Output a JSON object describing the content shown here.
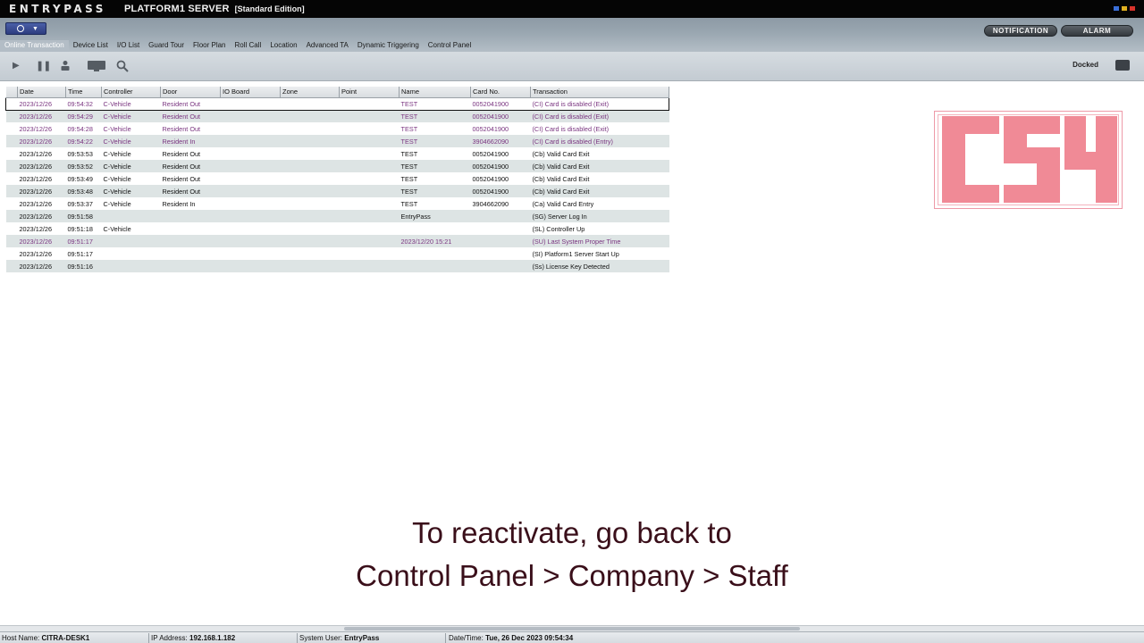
{
  "titlebar": {
    "logo": "ENTRYPASS",
    "product": "PLATFORM1 SERVER",
    "edition": "[Standard Edition]"
  },
  "tabs": [
    {
      "label": "Online Transaction",
      "active": true
    },
    {
      "label": "Device List"
    },
    {
      "label": "I/O List"
    },
    {
      "label": "Guard Tour"
    },
    {
      "label": "Floor Plan"
    },
    {
      "label": "Roll Call"
    },
    {
      "label": "Location"
    },
    {
      "label": "Advanced TA"
    },
    {
      "label": "Dynamic Triggering"
    },
    {
      "label": "Control Panel"
    }
  ],
  "header_buttons": {
    "notification": "NOTIFICATION",
    "alarm": "ALARM"
  },
  "toolbar": {
    "docked_label": "Docked"
  },
  "grid": {
    "columns": [
      "Date",
      "Time",
      "Controller",
      "Door",
      "IO Board",
      "Zone",
      "Point",
      "Name",
      "Card No.",
      "Transaction"
    ],
    "rows": [
      [
        "2023/12/26",
        "09:54:32",
        "C-Vehicle",
        "Resident Out",
        "",
        "",
        "",
        "TEST",
        "0052041900",
        "(CI) Card is disabled (Exit)"
      ],
      [
        "2023/12/26",
        "09:54:29",
        "C-Vehicle",
        "Resident Out",
        "",
        "",
        "",
        "TEST",
        "0052041900",
        "(CI) Card is disabled (Exit)"
      ],
      [
        "2023/12/26",
        "09:54:28",
        "C-Vehicle",
        "Resident Out",
        "",
        "",
        "",
        "TEST",
        "0052041900",
        "(CI) Card is disabled (Exit)"
      ],
      [
        "2023/12/26",
        "09:54:22",
        "C-Vehicle",
        "Resident In",
        "",
        "",
        "",
        "TEST",
        "3904662090",
        "(CI) Card is disabled (Entry)"
      ],
      [
        "2023/12/26",
        "09:53:53",
        "C-Vehicle",
        "Resident Out",
        "",
        "",
        "",
        "TEST",
        "0052041900",
        "(Cb) Valid Card Exit"
      ],
      [
        "2023/12/26",
        "09:53:52",
        "C-Vehicle",
        "Resident Out",
        "",
        "",
        "",
        "TEST",
        "0052041900",
        "(Cb) Valid Card Exit"
      ],
      [
        "2023/12/26",
        "09:53:49",
        "C-Vehicle",
        "Resident Out",
        "",
        "",
        "",
        "TEST",
        "0052041900",
        "(Cb) Valid Card Exit"
      ],
      [
        "2023/12/26",
        "09:53:48",
        "C-Vehicle",
        "Resident Out",
        "",
        "",
        "",
        "TEST",
        "0052041900",
        "(Cb) Valid Card Exit"
      ],
      [
        "2023/12/26",
        "09:53:37",
        "C-Vehicle",
        "Resident In",
        "",
        "",
        "",
        "TEST",
        "3904662090",
        "(Ca) Valid Card Entry"
      ],
      [
        "2023/12/26",
        "09:51:58",
        "",
        "",
        "",
        "",
        "",
        "EntryPass",
        "",
        "(SG) Server Log In"
      ],
      [
        "2023/12/26",
        "09:51:18",
        "C-Vehicle",
        "",
        "",
        "",
        "",
        "",
        "",
        "(SL) Controller Up"
      ],
      [
        "2023/12/26",
        "09:51:17",
        "",
        "",
        "",
        "",
        "",
        "2023/12/20 15:21",
        "",
        "(SU) Last System Proper Time"
      ],
      [
        "2023/12/26",
        "09:51:17",
        "",
        "",
        "",
        "",
        "",
        "",
        "",
        "(SI) Platform1 Server Start Up"
      ],
      [
        "2023/12/26",
        "09:51:16",
        "",
        "",
        "",
        "",
        "",
        "",
        "",
        "(Ss) License Key Detected"
      ]
    ],
    "disabled_rows": [
      0,
      1,
      2,
      3,
      11
    ],
    "selected_row": 0
  },
  "stamp": {
    "text": "CSY",
    "color": "#f08a96"
  },
  "caption": {
    "line1": "To reactivate, go back to",
    "line2": "Control Panel > Company > Staff"
  },
  "statusbar": {
    "host_label": "Host Name:",
    "host_value": "CITRA-DESK1",
    "ip_label": "IP Address:",
    "ip_value": "192.168.1.182",
    "user_label": "System User:",
    "user_value": "EntryPass",
    "datetime_label": "Date/Time:",
    "datetime_value": "Tue, 26 Dec 2023 09:54:34"
  }
}
